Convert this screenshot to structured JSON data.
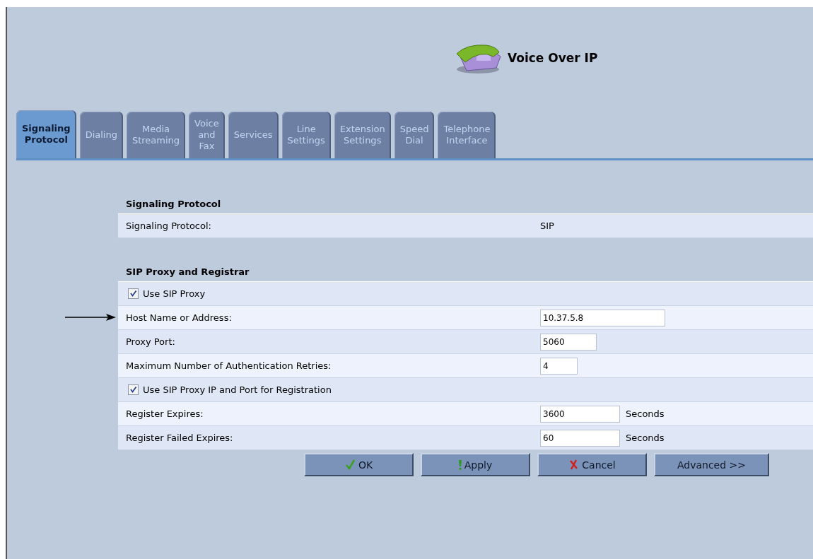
{
  "header": {
    "title": "Voice Over IP"
  },
  "tabs": [
    {
      "label": "Signaling Protocol",
      "selected": true
    },
    {
      "label": "Dialing",
      "selected": false
    },
    {
      "label": "Media Streaming",
      "selected": false
    },
    {
      "label": "Voice and Fax",
      "selected": false
    },
    {
      "label": "Services",
      "selected": false
    },
    {
      "label": "Line Settings",
      "selected": false
    },
    {
      "label": "Extension Settings",
      "selected": false
    },
    {
      "label": "Speed Dial",
      "selected": false
    },
    {
      "label": "Telephone Interface",
      "selected": false
    }
  ],
  "sections": [
    {
      "title": "Signaling Protocol",
      "rows": [
        {
          "kind": "readonly",
          "label": "Signaling Protocol:",
          "value": "SIP"
        }
      ]
    },
    {
      "title": "SIP Proxy and Registrar",
      "rows": [
        {
          "kind": "checkbox",
          "label": "Use SIP Proxy",
          "checked": true
        },
        {
          "kind": "input",
          "label": "Host Name or Address:",
          "value": "10.37.5.8",
          "pointed": true
        },
        {
          "kind": "input",
          "label": "Proxy Port:",
          "value": "5060"
        },
        {
          "kind": "input",
          "label": "Maximum Number of Authentication Retries:",
          "value": "4"
        },
        {
          "kind": "checkbox",
          "label": "Use SIP Proxy IP and Port for Registration",
          "checked": true
        },
        {
          "kind": "input",
          "label": "Register Expires:",
          "value": "3600",
          "unit": "Seconds"
        },
        {
          "kind": "input",
          "label": "Register Failed Expires:",
          "value": "60",
          "unit": "Seconds"
        }
      ]
    }
  ],
  "buttons": [
    {
      "kind": "ok",
      "label": "OK"
    },
    {
      "kind": "apply",
      "label": "Apply"
    },
    {
      "kind": "cancel",
      "label": "Cancel"
    },
    {
      "kind": "plain",
      "label": "Advanced >>"
    }
  ]
}
